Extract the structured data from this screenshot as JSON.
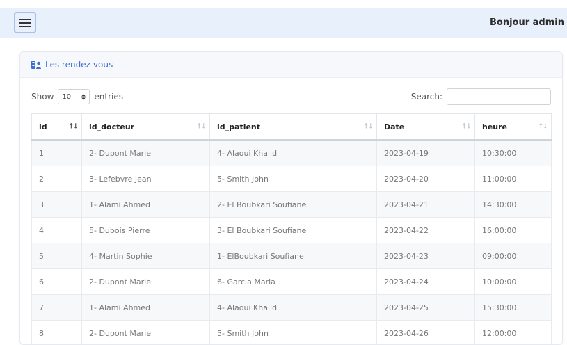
{
  "header": {
    "menu_icon": "hamburger-icon",
    "greeting": "Bonjour admin"
  },
  "card": {
    "title_icon": "user-card-icon",
    "title": "Les rendez-vous"
  },
  "controls": {
    "show_label": "Show",
    "page_size": "10",
    "entries_label": "entries",
    "search_label": "Search:",
    "search_value": ""
  },
  "table": {
    "columns": [
      "id",
      "id_docteur",
      "id_patient",
      "Date",
      "heure"
    ],
    "rows": [
      [
        "1",
        "2- Dupont Marie",
        "4- Alaoui Khalid",
        "2023-04-19",
        "10:30:00"
      ],
      [
        "2",
        "3- Lefebvre Jean",
        "5- Smith John",
        "2023-04-20",
        "11:00:00"
      ],
      [
        "3",
        "1- Alami Ahmed",
        "2- El Boubkari Soufiane",
        "2023-04-21",
        "14:30:00"
      ],
      [
        "4",
        "5- Dubois Pierre",
        "3- El Boubkari Soufiane",
        "2023-04-22",
        "16:00:00"
      ],
      [
        "5",
        "4- Martin Sophie",
        "1- ElBoubkari Soufiane",
        "2023-04-23",
        "09:00:00"
      ],
      [
        "6",
        "2- Dupont Marie",
        "6- Garcia Maria",
        "2023-04-24",
        "10:00:00"
      ],
      [
        "7",
        "1- Alami Ahmed",
        "4- Alaoui Khalid",
        "2023-04-25",
        "15:30:00"
      ],
      [
        "8",
        "2- Dupont Marie",
        "5- Smith John",
        "2023-04-26",
        "12:00:00"
      ]
    ]
  },
  "colors": {
    "accent": "#3b6fd6",
    "topbar_bg": "#e8f0fc"
  }
}
